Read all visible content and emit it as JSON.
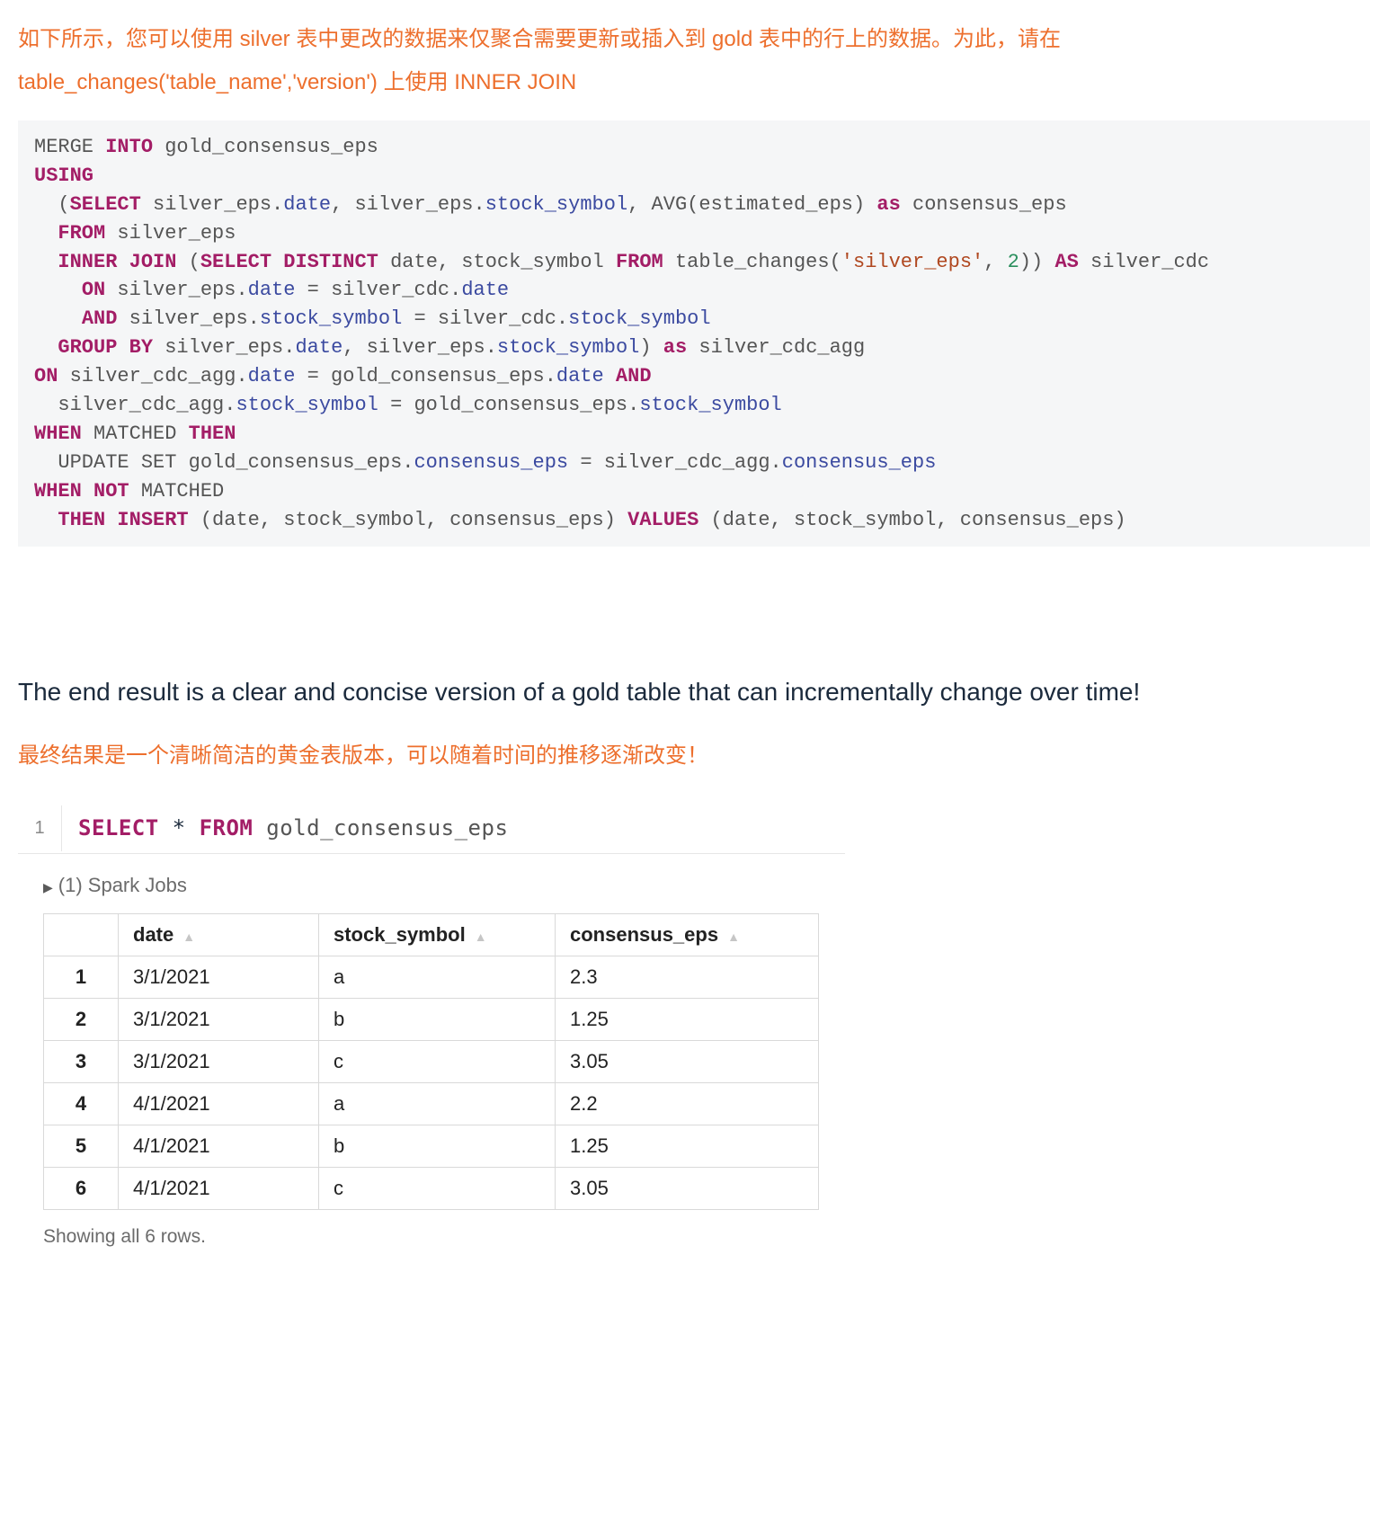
{
  "intro_cn": "如下所示，您可以使用 silver 表中更改的数据来仅聚合需要更新或插入到 gold 表中的行上的数据。为此，请在 table_changes('table_name','version') 上使用 INNER JOIN",
  "sql": {
    "l1": {
      "a": "MERGE ",
      "b": "INTO",
      "c": " gold_consensus_eps"
    },
    "l2": "USING",
    "l3": {
      "a": "  (",
      "b": "SELECT",
      "c": " silver_eps.",
      "d": "date",
      "e": ", silver_eps.",
      "f": "stock_symbol",
      "g": ", AVG(estimated_eps) ",
      "h": "as",
      "i": " consensus_eps"
    },
    "l4": {
      "a": "  ",
      "b": "FROM",
      "c": " silver_eps"
    },
    "l5": {
      "a": "  ",
      "b": "INNER JOIN",
      "c": " (",
      "d": "SELECT DISTINCT",
      "e": " date, stock_symbol ",
      "f": "FROM",
      "g": " table_changes(",
      "h": "'silver_eps'",
      "i": ", ",
      "j": "2",
      "k": ")) ",
      "l": "AS",
      "m": " silver_cdc"
    },
    "l6": {
      "a": "    ",
      "b": "ON",
      "c": " silver_eps.",
      "d": "date",
      "e": " = silver_cdc.",
      "f": "date"
    },
    "l7": {
      "a": "    ",
      "b": "AND",
      "c": " silver_eps.",
      "d": "stock_symbol",
      "e": " = silver_cdc.",
      "f": "stock_symbol"
    },
    "l8": {
      "a": "  ",
      "b": "GROUP BY",
      "c": " silver_eps.",
      "d": "date",
      "e": ", silver_eps.",
      "f": "stock_symbol",
      "g": ") ",
      "h": "as",
      "i": " silver_cdc_agg"
    },
    "l9": {
      "a": "ON",
      "b": " silver_cdc_agg.",
      "c": "date",
      "d": " = gold_consensus_eps.",
      "e": "date",
      "f": " ",
      "g": "AND"
    },
    "l10": {
      "a": "  silver_cdc_agg.",
      "b": "stock_symbol",
      "c": " = gold_consensus_eps.",
      "d": "stock_symbol"
    },
    "l11": {
      "a": "WHEN",
      "b": " MATCHED ",
      "c": "THEN"
    },
    "l12": {
      "a": "  UPDATE SET",
      "b": " gold_consensus_eps.",
      "c": "consensus_eps",
      "d": " = silver_cdc_agg.",
      "e": "consensus_eps"
    },
    "l13": {
      "a": "WHEN NOT",
      "b": " MATCHED"
    },
    "l14": {
      "a": "  ",
      "b": "THEN INSERT",
      "c": " (date, stock_symbol, consensus_eps) ",
      "d": "VALUES",
      "e": " (date, stock_symbol, consensus_eps)"
    }
  },
  "en_para": "The end result is a clear and concise version of a gold table that can incrementally change over time!",
  "closing_cn": "最终结果是一个清晰简洁的黄金表版本，可以随着时间的推移逐渐改变！",
  "cell": {
    "num": "1",
    "kw1": "SELECT",
    "star": " * ",
    "kw2": "FROM",
    "tbl": " gold_consensus_eps"
  },
  "jobs": "(1) Spark Jobs",
  "table": {
    "headers": {
      "date": "date",
      "sym": "stock_symbol",
      "eps": "consensus_eps"
    },
    "rows": [
      {
        "idx": "1",
        "date": "3/1/2021",
        "sym": "a",
        "eps": "2.3"
      },
      {
        "idx": "2",
        "date": "3/1/2021",
        "sym": "b",
        "eps": "1.25"
      },
      {
        "idx": "3",
        "date": "3/1/2021",
        "sym": "c",
        "eps": "3.05"
      },
      {
        "idx": "4",
        "date": "4/1/2021",
        "sym": "a",
        "eps": "2.2"
      },
      {
        "idx": "5",
        "date": "4/1/2021",
        "sym": "b",
        "eps": "1.25"
      },
      {
        "idx": "6",
        "date": "4/1/2021",
        "sym": "c",
        "eps": "3.05"
      }
    ]
  },
  "rows_note": "Showing all 6 rows."
}
